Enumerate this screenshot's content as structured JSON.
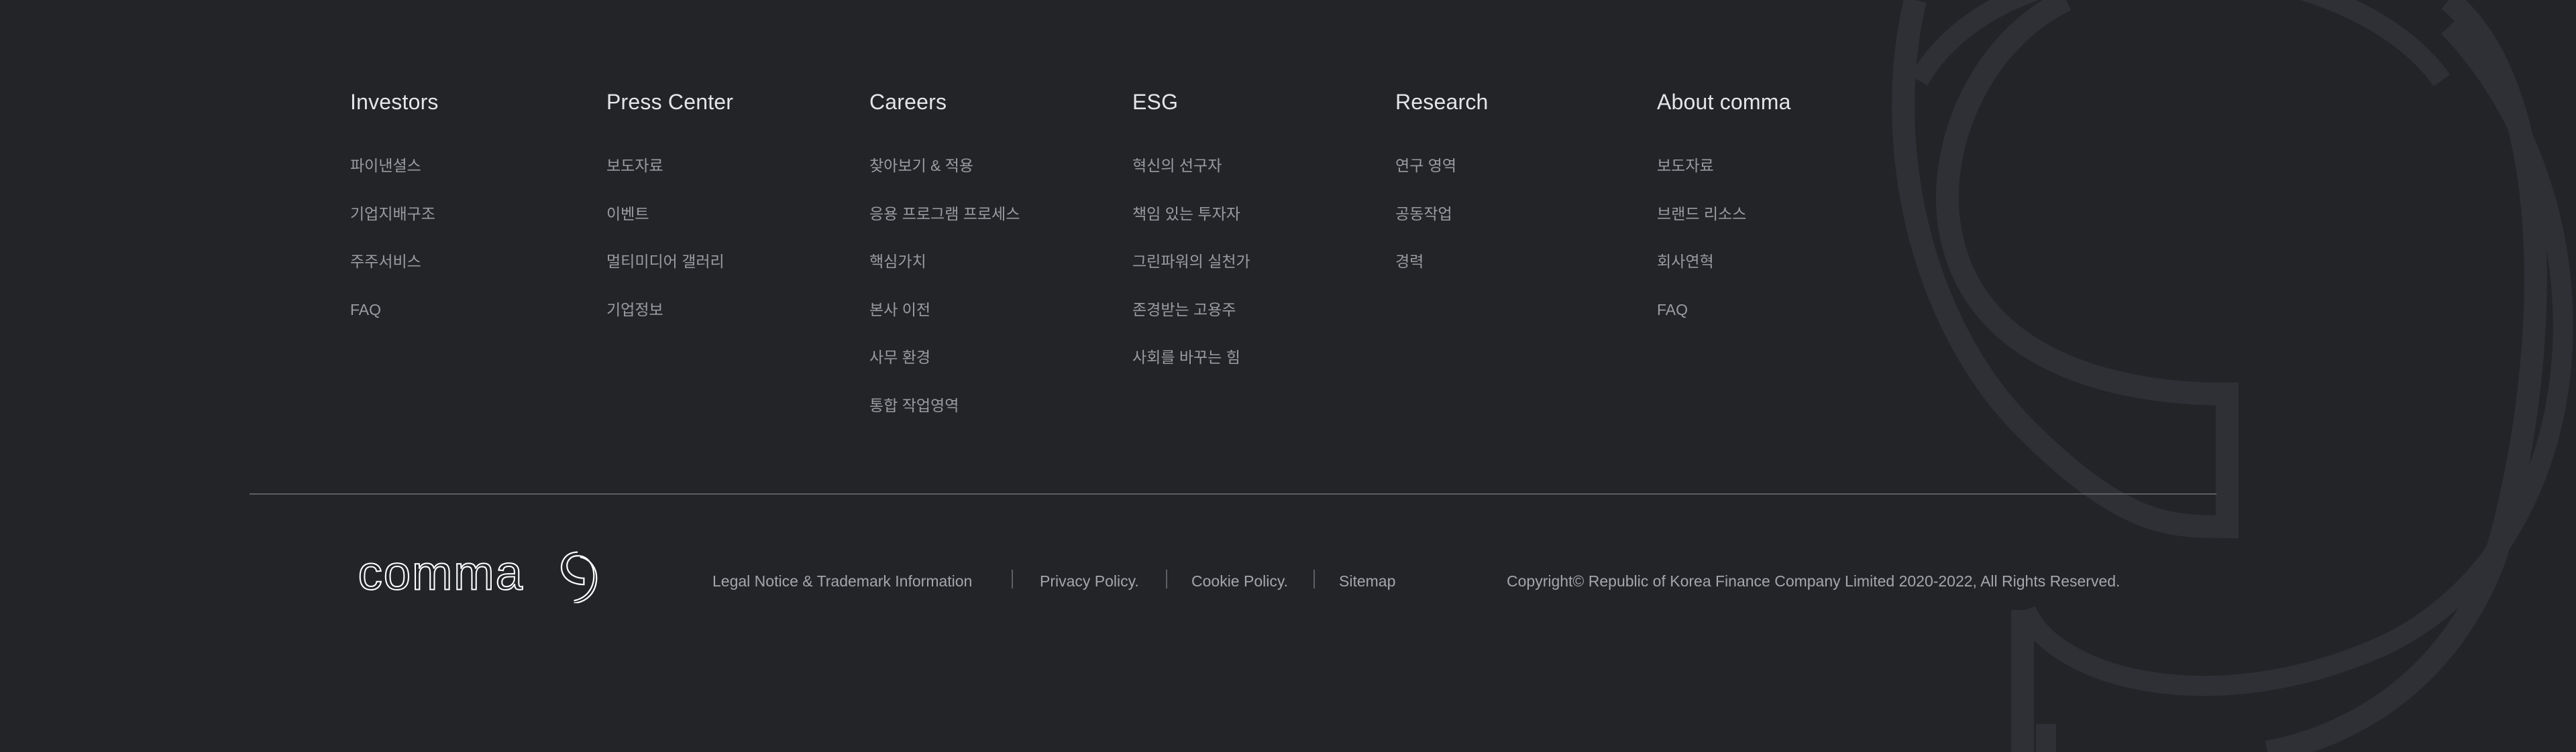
{
  "columns": [
    {
      "title": "Investors",
      "items": [
        "파이낸셜스",
        "기업지배구조",
        "주주서비스",
        "FAQ"
      ]
    },
    {
      "title": "Press Center",
      "items": [
        "보도자료",
        "이벤트",
        "멀티미디어 갤러리",
        "기업정보"
      ]
    },
    {
      "title": "Careers",
      "items": [
        "찾아보기 & 적용",
        "응용 프로그램 프로세스",
        "핵심가치",
        "본사 이전",
        "사무 환경",
        "통합 작업영역"
      ]
    },
    {
      "title": "ESG",
      "items": [
        "혁신의 선구자",
        "책임 있는 투자자",
        "그린파워의 실천가",
        "존경받는 고용주",
        "사회를 바꾸는 힘"
      ]
    },
    {
      "title": "Research",
      "items": [
        "연구 영역",
        "공동작업",
        "경력"
      ]
    },
    {
      "title": "About comma",
      "items": [
        "보도자료",
        "브랜드 리소스",
        "회사연혁",
        "FAQ"
      ]
    }
  ],
  "logo": {
    "text": "comma",
    "icon": "comma-logo-icon"
  },
  "legal_links": [
    "Legal Notice & Trademark Information",
    "Privacy Policy.",
    "Cookie Policy.",
    "Sitemap"
  ],
  "copyright": "Copyright© Republic of Korea Finance Company Limited 2020-2022, All Rights Reserved.",
  "colors": {
    "background": "#222428",
    "heading": "#e4e5e7",
    "link": "#9a9ca1",
    "divider": "#5d5f64",
    "watermark": "#2e3035"
  }
}
